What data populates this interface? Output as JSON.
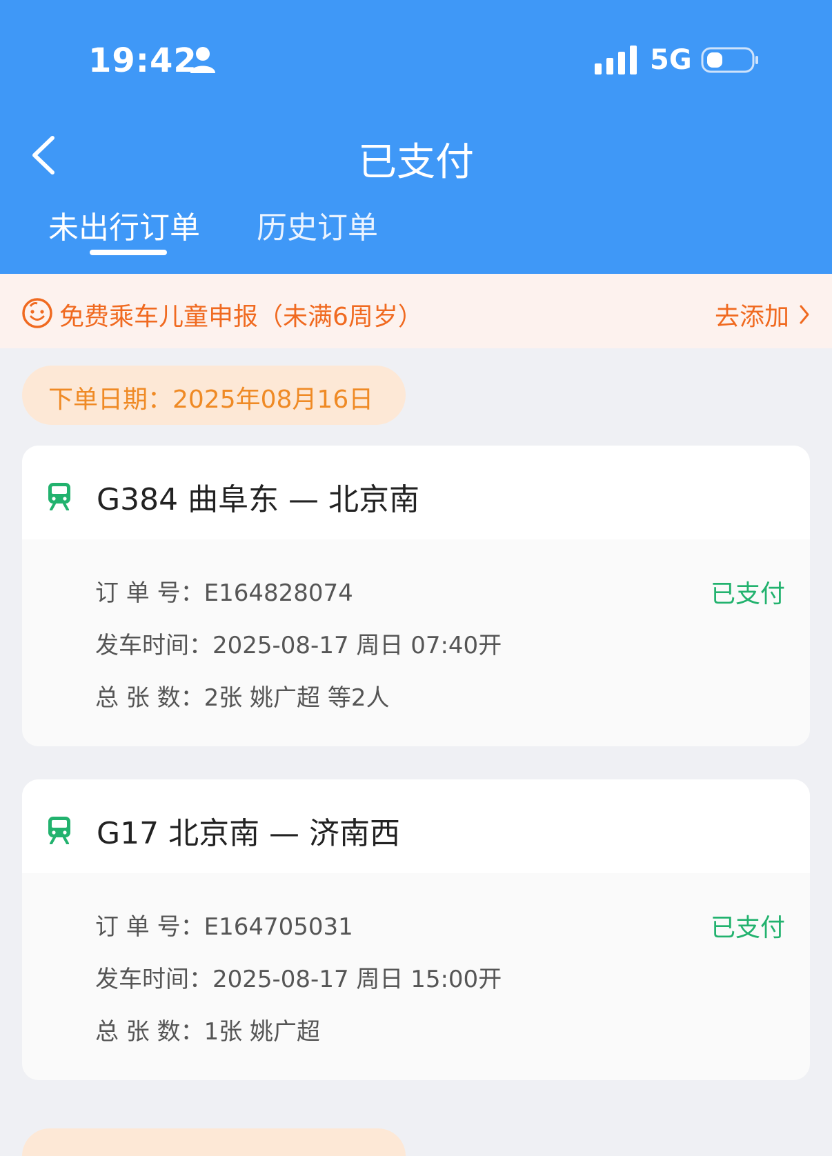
{
  "status_bar": {
    "time": "19:42",
    "network": "5G",
    "icons": [
      "person-icon",
      "signal-icon",
      "battery-icon"
    ]
  },
  "nav": {
    "back_icon": "chevron-left-icon",
    "title": "已支付",
    "tabs": [
      {
        "label": "未出行订单",
        "active": true
      },
      {
        "label": "历史订单",
        "active": false
      }
    ]
  },
  "notice": {
    "icon": "smile-icon",
    "text": "免费乘车儿童申报（未满6周岁）",
    "action": "去添加"
  },
  "order_group": {
    "date_label": "下单日期：2025年08月16日"
  },
  "orders": [
    {
      "title": "G384  曲阜东 — 北京南",
      "order_no": "订  单  号：E164828074",
      "status": "已支付",
      "depart": "发车时间：2025-08-17  周日  07:40开",
      "tickets": "总  张  数：2张  姚广超 等2人"
    },
    {
      "title": "G17  北京南 — 济南西",
      "order_no": "订  单  号：E164705031",
      "status": "已支付",
      "depart": "发车时间：2025-08-17  周日  15:00开",
      "tickets": "总  张  数：1张  姚广超"
    }
  ],
  "colors": {
    "header": "#3f98f7",
    "notice_bg": "#fdf2ee",
    "notice_text": "#f06a20",
    "date_pill_bg": "#fde8d6",
    "date_text": "#ef8a25",
    "paid_status": "#22b26e",
    "train_icon": "#22b26e",
    "page_bg": "#eff0f4"
  }
}
